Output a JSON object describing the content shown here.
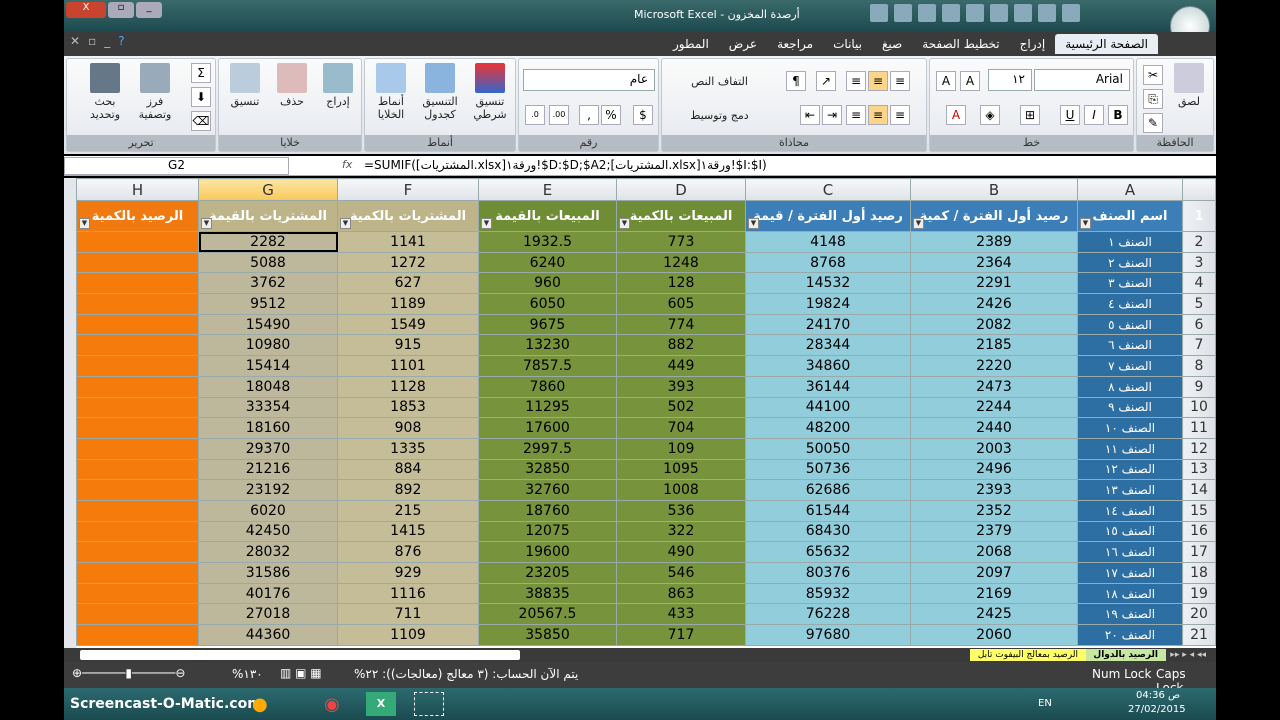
{
  "window": {
    "title": "Microsoft Excel - أرصدة المخزون"
  },
  "window_buttons": [
    "X",
    "▫",
    "_"
  ],
  "quick_access": [
    "save-icon",
    "undo-icon",
    "redo-icon",
    "sort-desc-icon",
    "sort-asc-icon",
    "grid-icon",
    "form-icon",
    "brush-icon",
    "table-icon"
  ],
  "tabs": [
    "الصفحة الرئيسية",
    "إدراج",
    "تخطيط الصفحة",
    "صيغ",
    "بيانات",
    "مراجعة",
    "عرض",
    "المطور"
  ],
  "active_tab": "الصفحة الرئيسية",
  "ribbon": {
    "clipboard": {
      "label": "الحافظة",
      "paste": "لصق"
    },
    "font": {
      "label": "خط",
      "font_name": "Arial",
      "font_size": "١٢",
      "bold": "B",
      "italic": "I",
      "underline": "U"
    },
    "alignment": {
      "label": "محاذاة",
      "wrap": "التفاف النص",
      "merge": "دمج وتوسيط"
    },
    "number": {
      "label": "رقم",
      "format": "عام",
      "percent": "%",
      "comma": ","
    },
    "styles": {
      "label": "أنماط",
      "conditional": "تنسيق شرطي",
      "table": "التنسيق كجدول",
      "cell_styles": "أنماط الخلايا"
    },
    "cells": {
      "label": "خلايا",
      "insert": "إدراج",
      "delete": "حذف",
      "format": "تنسيق"
    },
    "editing": {
      "label": "تحرير",
      "sort": "فرز وتصفية",
      "find": "بحث وتحديد",
      "sum": "Σ"
    }
  },
  "formula_bar": {
    "name_box": "G2",
    "fx": "fx",
    "formula": "=SUMIF([المشتريات.xlsx]ورقة١!$D:$D;$A2;[المشتريات.xlsx]ورقة١!$I:$I)"
  },
  "columns": [
    "A",
    "B",
    "C",
    "D",
    "E",
    "F",
    "G",
    "H"
  ],
  "selected_column": "G",
  "headers": [
    "اسم الصنف",
    "رصيد أول الفترة / كمية",
    "رصيد أول الفترة / قيمة",
    "المبيعات بالكمية",
    "المبيعات بالقيمة",
    "المشتريات بالكمية",
    "المشتريات بالقيمة",
    "الرصيد بالكمية"
  ],
  "column_colors": {
    "A": "#2d6fa3",
    "B": "#92cddc",
    "C": "#92cddc",
    "D": "#77933c",
    "E": "#77933c",
    "F": "#c4bd97",
    "G": "#bdb89c",
    "H": "#f57c0c"
  },
  "header_colors": {
    "A": "#3c7fb8",
    "B": "#3c7fb8",
    "C": "#3c7fb8",
    "D": "#6e8d35",
    "E": "#6e8d35",
    "F": "#bdb48a",
    "G": "#bdb48a",
    "H": "#f07a10"
  },
  "rows": [
    [
      "الصنف ١",
      "2389",
      "4148",
      "773",
      "1932.5",
      "1141",
      "2282",
      ""
    ],
    [
      "الصنف ٢",
      "2364",
      "8768",
      "1248",
      "6240",
      "1272",
      "5088",
      ""
    ],
    [
      "الصنف ٣",
      "2291",
      "14532",
      "128",
      "960",
      "627",
      "3762",
      ""
    ],
    [
      "الصنف ٤",
      "2426",
      "19824",
      "605",
      "6050",
      "1189",
      "9512",
      ""
    ],
    [
      "الصنف ٥",
      "2082",
      "24170",
      "774",
      "9675",
      "1549",
      "15490",
      ""
    ],
    [
      "الصنف ٦",
      "2185",
      "28344",
      "882",
      "13230",
      "915",
      "10980",
      ""
    ],
    [
      "الصنف ٧",
      "2220",
      "34860",
      "449",
      "7857.5",
      "1101",
      "15414",
      ""
    ],
    [
      "الصنف ٨",
      "2473",
      "36144",
      "393",
      "7860",
      "1128",
      "18048",
      ""
    ],
    [
      "الصنف ٩",
      "2244",
      "44100",
      "502",
      "11295",
      "1853",
      "33354",
      ""
    ],
    [
      "الصنف ١٠",
      "2440",
      "48200",
      "704",
      "17600",
      "908",
      "18160",
      ""
    ],
    [
      "الصنف ١١",
      "2003",
      "50050",
      "109",
      "2997.5",
      "1335",
      "29370",
      ""
    ],
    [
      "الصنف ١٢",
      "2496",
      "50736",
      "1095",
      "32850",
      "884",
      "21216",
      ""
    ],
    [
      "الصنف ١٣",
      "2393",
      "62686",
      "1008",
      "32760",
      "892",
      "23192",
      ""
    ],
    [
      "الصنف ١٤",
      "2352",
      "61544",
      "536",
      "18760",
      "215",
      "6020",
      ""
    ],
    [
      "الصنف ١٥",
      "2379",
      "68430",
      "322",
      "12075",
      "1415",
      "42450",
      ""
    ],
    [
      "الصنف ١٦",
      "2068",
      "65632",
      "490",
      "19600",
      "876",
      "28032",
      ""
    ],
    [
      "الصنف ١٧",
      "2097",
      "80376",
      "546",
      "23205",
      "929",
      "31586",
      ""
    ],
    [
      "الصنف ١٨",
      "2169",
      "85932",
      "863",
      "38835",
      "1116",
      "40176",
      ""
    ],
    [
      "الصنف ١٩",
      "2425",
      "76228",
      "433",
      "20567.5",
      "711",
      "27018",
      ""
    ],
    [
      "الصنف ٢٠",
      "2060",
      "97680",
      "717",
      "35850",
      "1109",
      "44360",
      ""
    ]
  ],
  "sheet_tabs": [
    {
      "label": "الرصيد بالدوال",
      "color": "#c6e8a0",
      "active": true
    },
    {
      "label": "الرصيد بمعالج البيفوت تابل",
      "color": "#ffff66",
      "active": false
    }
  ],
  "status": {
    "calc": "يتم الآن الحساب: (٣ معالج (معالجات)): ٢٢%",
    "zoom": "%١٣٠",
    "num_lock": "Num Lock",
    "caps_lock": "Caps Lock"
  },
  "taskbar": {
    "watermark": "Screencast-O-Matic.com",
    "lang": "EN",
    "time": "04:36 ص",
    "date": "27/02/2015"
  }
}
